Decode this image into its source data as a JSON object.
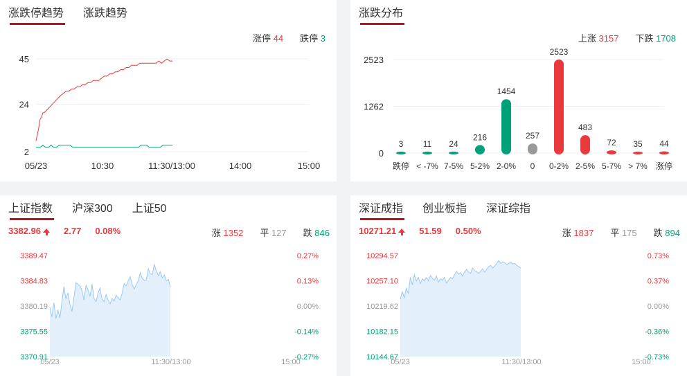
{
  "colors": {
    "up": "#e8393c",
    "down": "#00a07a",
    "flat": "#999999",
    "accent": "#b3121e",
    "area": "#e3f0fc",
    "areaLine": "#9cc9ef"
  },
  "limit_panel": {
    "tabs": [
      "涨跌停趋势",
      "涨跌趋势"
    ],
    "up_label": "涨停",
    "up_value": "44",
    "down_label": "跌停",
    "down_value": "3"
  },
  "dist_panel": {
    "tabs": [
      "涨跌分布"
    ],
    "up_label": "上涨",
    "up_value": "3157",
    "down_label": "下跌",
    "down_value": "1708"
  },
  "sh_panel": {
    "tabs": [
      "上证指数",
      "沪深300",
      "上证50"
    ],
    "price": "3382.96",
    "change": "2.77",
    "pct": "0.08%",
    "up_label": "涨",
    "up_value": "1352",
    "flat_label": "平",
    "flat_value": "127",
    "down_label": "跌",
    "down_value": "846"
  },
  "sz_panel": {
    "tabs": [
      "深证成指",
      "创业板指",
      "深证综指"
    ],
    "price": "10271.21",
    "change": "51.59",
    "pct": "0.50%",
    "up_label": "涨",
    "up_value": "1837",
    "flat_label": "平",
    "flat_value": "175",
    "down_label": "跌",
    "down_value": "894"
  },
  "chart_data": [
    {
      "type": "line",
      "xticks": [
        "05/23",
        "10:30",
        "11:30/13:00",
        "14:00",
        "15:00"
      ],
      "yticks": [
        "45",
        "24",
        "2"
      ],
      "ylim": [
        2,
        45
      ],
      "series": [
        {
          "name": "涨停",
          "x": [
            0,
            2,
            4,
            6,
            8,
            10,
            12,
            15,
            18,
            21,
            24,
            27,
            30,
            33,
            36,
            40,
            44,
            48,
            52,
            56,
            60,
            64,
            68,
            72,
            76,
            80,
            84,
            88,
            92,
            96,
            100,
            104,
            108,
            112,
            116,
            120,
            124,
            128,
            132,
            136,
            140,
            144,
            148,
            152,
            156,
            160,
            164,
            168,
            172,
            176,
            180,
            184,
            188,
            192,
            196,
            200
          ],
          "values": [
            7,
            10,
            13,
            17,
            18,
            20,
            20,
            21,
            22,
            23,
            24,
            25,
            26,
            27,
            28,
            29,
            30,
            30,
            31,
            31,
            32,
            32,
            33,
            33,
            34,
            34,
            35,
            35,
            35,
            36,
            37,
            37,
            38,
            38,
            39,
            39,
            40,
            40,
            41,
            41,
            42,
            42,
            42,
            43,
            43,
            43,
            43,
            43,
            43,
            43,
            44,
            43,
            44,
            45,
            44,
            44
          ]
        },
        {
          "name": "跌停",
          "x": [
            0,
            6,
            10,
            14,
            18,
            22,
            26,
            30,
            34,
            38,
            42,
            46,
            50,
            54,
            58,
            62,
            66,
            70,
            74,
            78,
            82,
            86,
            90,
            94,
            98,
            102,
            106,
            110,
            114,
            118,
            122,
            126,
            130,
            134,
            138,
            142,
            146,
            150,
            154,
            158,
            162,
            166,
            170,
            174,
            178,
            182,
            186,
            190,
            194,
            198,
            200
          ],
          "values": [
            4,
            4,
            5,
            4,
            4,
            5,
            4,
            4,
            5,
            5,
            5,
            5,
            5,
            4,
            4,
            4,
            4,
            4,
            4,
            4,
            4,
            4,
            4,
            4,
            4,
            4,
            4,
            4,
            4,
            4,
            4,
            4,
            4,
            4,
            4,
            4,
            4,
            4,
            5,
            5,
            5,
            4,
            4,
            4,
            4,
            4,
            5,
            5,
            5,
            5,
            5
          ]
        }
      ]
    },
    {
      "type": "bar",
      "categories": [
        "跌停",
        "< -7%",
        "7-5%",
        "5-2%",
        "2-0%",
        "0",
        "0-2%",
        "2-5%",
        "5-7%",
        "> 7%",
        "涨停"
      ],
      "values": [
        3,
        11,
        24,
        216,
        1454,
        257,
        2523,
        483,
        72,
        35,
        44
      ],
      "colors": [
        "#00a07a",
        "#00a07a",
        "#00a07a",
        "#00a07a",
        "#00a07a",
        "#999999",
        "#e8393c",
        "#e8393c",
        "#e8393c",
        "#e8393c",
        "#e8393c"
      ],
      "yticks": [
        "2523",
        "1262",
        "0"
      ],
      "ylim": [
        0,
        2523
      ]
    },
    {
      "type": "area",
      "xticks": [
        "05/23",
        "11:30/13:00",
        "15:00"
      ],
      "yticks_left": [
        "3389.47",
        "3384.83",
        "3380.19",
        "3375.55",
        "3370.91"
      ],
      "yticks_right": [
        "0.27%",
        "0.13%",
        "0.00%",
        "-0.14%",
        "-0.27%"
      ],
      "ylim": [
        3370.91,
        3389.47
      ],
      "x": [
        0,
        2,
        4,
        6,
        8,
        10,
        12,
        14,
        16,
        18,
        20,
        22,
        24,
        26,
        28,
        30,
        32,
        34,
        36,
        38,
        40,
        42,
        44,
        46,
        48,
        50,
        52,
        54,
        56,
        58,
        60,
        62,
        64,
        66,
        68,
        70,
        72,
        74,
        76,
        78,
        80,
        82,
        84,
        86,
        88,
        90,
        92,
        94,
        96,
        98,
        100,
        102,
        104,
        106,
        108,
        110,
        112,
        114,
        116,
        118,
        120
      ],
      "values": [
        3380.0,
        3378.2,
        3380.8,
        3377.9,
        3379.5,
        3378.0,
        3380.9,
        3383.8,
        3381.5,
        3382.6,
        3380.5,
        3379.2,
        3381.8,
        3384.5,
        3384.2,
        3383.9,
        3383.0,
        3381.3,
        3384.0,
        3383.2,
        3382.0,
        3384.2,
        3381.6,
        3381.0,
        3382.6,
        3383.5,
        3381.4,
        3381.0,
        3382.3,
        3381.3,
        3380.6,
        3381.6,
        3381.1,
        3382.2,
        3381.7,
        3381.3,
        3382.6,
        3384.3,
        3383.9,
        3384.8,
        3385.6,
        3384.1,
        3383.3,
        3384.1,
        3384.8,
        3386.3,
        3385.3,
        3384.9,
        3385.0,
        3387.0,
        3386.1,
        3386.0,
        3387.8,
        3386.7,
        3385.8,
        3386.5,
        3385.4,
        3385.9,
        3384.8,
        3385.1,
        3383.6
      ]
    },
    {
      "type": "area",
      "xticks": [
        "05/23",
        "11:30/13:00",
        "15:00"
      ],
      "yticks_left": [
        "10294.57",
        "10257.10",
        "10219.62",
        "10182.15",
        "10144.67"
      ],
      "yticks_right": [
        "0.73%",
        "0.37%",
        "0.00%",
        "-0.36%",
        "-0.73%"
      ],
      "ylim": [
        10144.67,
        10294.57
      ],
      "x": [
        0,
        2,
        4,
        6,
        8,
        10,
        12,
        14,
        16,
        18,
        20,
        22,
        24,
        26,
        28,
        30,
        32,
        34,
        36,
        38,
        40,
        42,
        44,
        46,
        48,
        50,
        52,
        54,
        56,
        58,
        60,
        62,
        64,
        66,
        68,
        70,
        72,
        74,
        76,
        78,
        80,
        82,
        84,
        86,
        88,
        90,
        92,
        94,
        96,
        98,
        100,
        102,
        104,
        106,
        108,
        110,
        112,
        114,
        116,
        118,
        120
      ],
      "values": [
        10230.0,
        10241.0,
        10232.0,
        10246.0,
        10238.0,
        10262.0,
        10251.0,
        10266.0,
        10257.0,
        10262.0,
        10253.0,
        10260.0,
        10257.0,
        10262.0,
        10257.0,
        10265.0,
        10261.0,
        10258.0,
        10264.0,
        10255.0,
        10260.0,
        10258.0,
        10262.0,
        10254.0,
        10258.0,
        10262.0,
        10260.0,
        10266.0,
        10271.0,
        10267.0,
        10269.0,
        10264.0,
        10270.0,
        10274.0,
        10270.0,
        10268.0,
        10276.0,
        10272.0,
        10271.0,
        10268.0,
        10271.0,
        10275.0,
        10270.0,
        10274.0,
        10278.0,
        10280.0,
        10276.0,
        10279.0,
        10283.0,
        10287.0,
        10283.0,
        10285.0,
        10284.0,
        10281.0,
        10283.0,
        10285.0,
        10282.0,
        10283.0,
        10280.0,
        10278.0,
        10276.0
      ]
    }
  ]
}
